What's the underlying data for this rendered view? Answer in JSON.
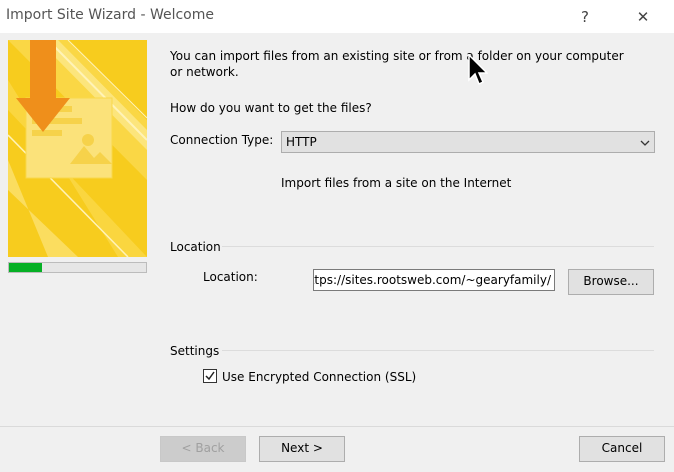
{
  "window": {
    "title": "Import Site Wizard - Welcome",
    "help_glyph": "?",
    "close_glyph": "✕"
  },
  "progress": {
    "value": 0.24
  },
  "intro_text": "You can import files from an existing site or from a folder on your computer or network.",
  "question": "How do you want to get the files?",
  "connection": {
    "label": "Connection Type:",
    "value": "HTTP",
    "description": "Import files from a site on the Internet"
  },
  "location_group": {
    "title": "Location",
    "label": "Location:",
    "value": "https://sites.rootsweb.com/~gearyfamily/",
    "browse": "Browse..."
  },
  "settings_group": {
    "title": "Settings",
    "ssl_label": "Use Encrypted Connection (SSL)",
    "ssl_checked": true
  },
  "footer": {
    "back": "< Back",
    "next": "Next >",
    "cancel": "Cancel"
  },
  "icons": {
    "help": "help-icon",
    "close": "close-icon",
    "chevron": "chevron-down-icon",
    "checkmark": "checkmark-icon",
    "banner": "import-arrow-illustration"
  },
  "colors": {
    "banner_yellow": "#f7cc1e",
    "arrow_orange": "#ef8f1b",
    "progress_green": "#06b025"
  }
}
